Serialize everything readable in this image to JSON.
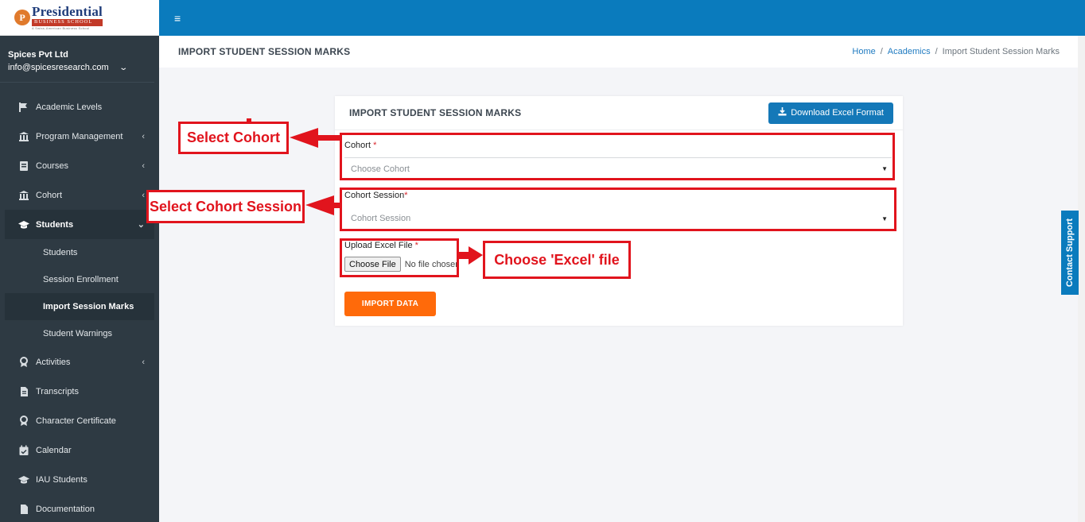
{
  "logo": {
    "initial": "P",
    "main": "Presidential",
    "sub": "BUSINESS SCHOOL",
    "tagline": "A Swiss-American Business School"
  },
  "user": {
    "org": "Spices Pvt Ltd",
    "email": "info@spicesresearch.com"
  },
  "sidebar": {
    "items": [
      {
        "label": "Academic Levels",
        "icon": "flag-icon"
      },
      {
        "label": "Program Management",
        "icon": "bank-icon"
      },
      {
        "label": "Courses",
        "icon": "book-icon"
      },
      {
        "label": "Cohort",
        "icon": "bank-icon"
      },
      {
        "label": "Students",
        "icon": "graduation-cap-icon"
      },
      {
        "label": "Activities",
        "icon": "award-icon"
      },
      {
        "label": "Transcripts",
        "icon": "file-icon"
      },
      {
        "label": "Character Certificate",
        "icon": "award-icon"
      },
      {
        "label": "Calendar",
        "icon": "calendar-check-icon"
      },
      {
        "label": "IAU Students",
        "icon": "graduation-cap-icon"
      },
      {
        "label": "Documentation",
        "icon": "file-icon"
      }
    ],
    "student_sub": [
      {
        "label": "Students"
      },
      {
        "label": "Session Enrollment"
      },
      {
        "label": "Import Session Marks"
      },
      {
        "label": "Student Warnings"
      }
    ]
  },
  "header": {
    "title": "IMPORT STUDENT SESSION MARKS",
    "breadcrumb": {
      "home": "Home",
      "academics": "Academics",
      "current": "Import Student Session Marks",
      "separator": "/"
    }
  },
  "card": {
    "title": "IMPORT STUDENT SESSION MARKS",
    "download_label": "Download Excel Format",
    "cohort_label": "Cohort",
    "cohort_placeholder": "Choose Cohort",
    "session_label": "Cohort Session",
    "session_placeholder": "Cohort Session",
    "file_label": "Upload Excel File",
    "file_button": "Choose File",
    "file_status": "No file chosen",
    "required_mark": "*",
    "import_label": "IMPORT DATA"
  },
  "annotations": {
    "select_cohort": "Select Cohort",
    "select_session": "Select Cohort Session",
    "choose_file": "Choose 'Excel' file"
  },
  "contact_support": "Contact Support",
  "colors": {
    "sidebar_bg": "#2e3a43",
    "topbar": "#0a7bbd",
    "annotation_red": "#e1141d",
    "import_orange": "#ff6a0a",
    "download_blue": "#1478b8"
  }
}
